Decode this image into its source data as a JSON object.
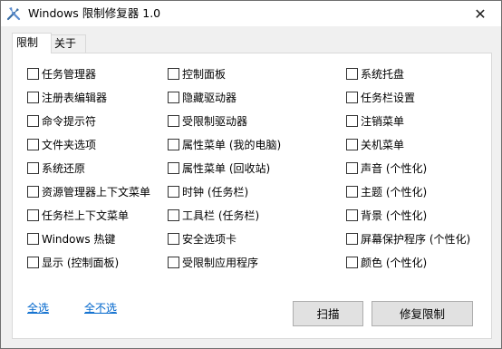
{
  "window": {
    "title": "Windows 限制修复器 1.0",
    "close_glyph": "✕"
  },
  "tabs": [
    "限制",
    "关于"
  ],
  "columns": [
    [
      "任务管理器",
      "注册表编辑器",
      "命令提示符",
      "文件夹选项",
      "系统还原",
      "资源管理器上下文菜单",
      "任务栏上下文菜单",
      "Windows 热键",
      "显示 (控制面板)"
    ],
    [
      "控制面板",
      "隐藏驱动器",
      "受限制驱动器",
      "属性菜单 (我的电脑)",
      "属性菜单 (回收站)",
      "时钟 (任务栏)",
      "工具栏 (任务栏)",
      "安全选项卡",
      "受限制应用程序"
    ],
    [
      "系统托盘",
      "任务栏设置",
      "注销菜单",
      "关机菜单",
      "声音 (个性化)",
      "主题 (个性化)",
      "背景 (个性化)",
      "屏幕保护程序 (个性化)",
      "颜色 (个性化)"
    ]
  ],
  "links": {
    "select_all": "全选",
    "select_none": "全不选"
  },
  "buttons": {
    "scan": "扫描",
    "repair": "修复限制"
  }
}
